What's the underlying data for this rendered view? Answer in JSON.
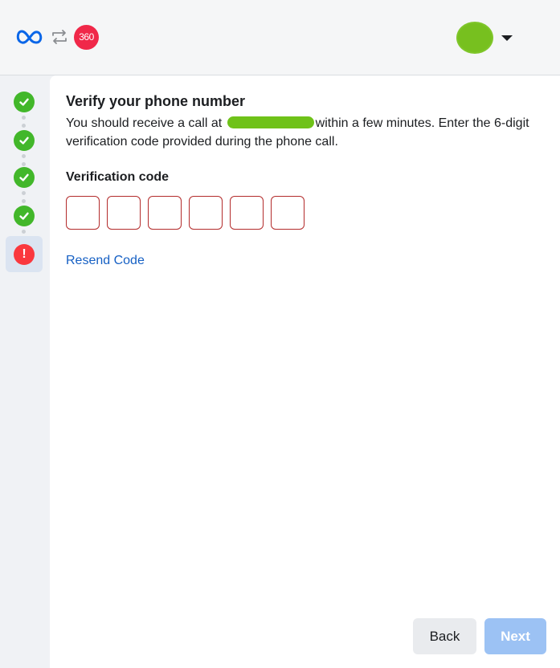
{
  "header": {
    "logos": {
      "primary": "meta-logo",
      "swap": "swap-icon",
      "badge_text": "360"
    },
    "account": {
      "avatar": "avatar",
      "menu_icon": "caret-down-icon"
    }
  },
  "steps": [
    {
      "state": "complete",
      "icon": "check-icon"
    },
    {
      "state": "complete",
      "icon": "check-icon"
    },
    {
      "state": "complete",
      "icon": "check-icon"
    },
    {
      "state": "complete",
      "icon": "check-icon"
    },
    {
      "state": "error",
      "icon": "exclamation-icon",
      "symbol": "!"
    }
  ],
  "form": {
    "title": "Verify your phone number",
    "description_before": "You should receive a call at",
    "description_after": "within a few minutes. Enter the 6-digit verification code provided during the phone call.",
    "code_label": "Verification code",
    "code_digits": [
      "",
      "",
      "",
      "",
      "",
      ""
    ],
    "resend_label": "Resend Code"
  },
  "actions": {
    "back_label": "Back",
    "next_label": "Next"
  },
  "colors": {
    "accent": "#1660c4",
    "success": "#42b72a",
    "error": "#fa383e",
    "next_disabled": "#9cc2f4"
  }
}
